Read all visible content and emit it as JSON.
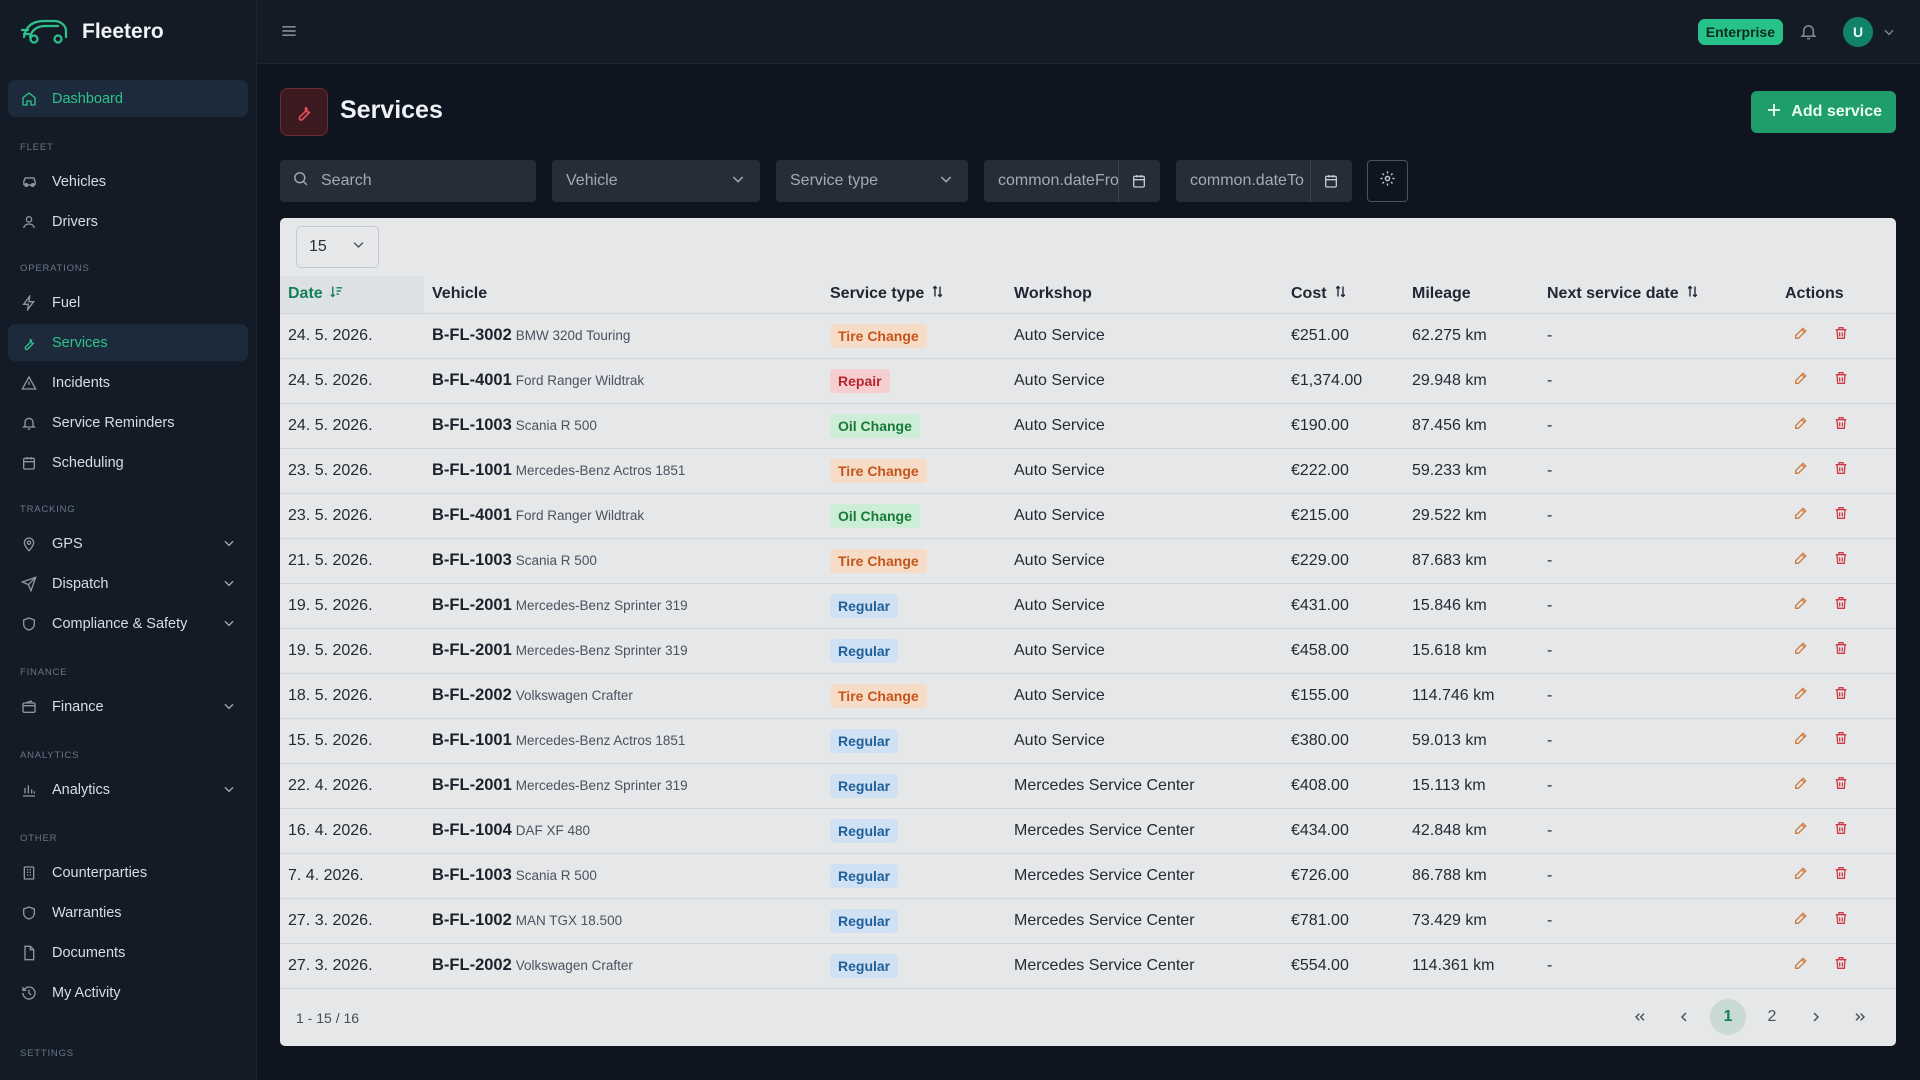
{
  "app": {
    "name": "Fleetero"
  },
  "topbar": {
    "plan_badge": "Enterprise",
    "avatar_initial": "U"
  },
  "sidebar": {
    "dashboard": "Dashboard",
    "sections": {
      "fleet": "FLEET",
      "operations": "OPERATIONS",
      "tracking": "TRACKING",
      "finance": "FINANCE",
      "analytics": "ANALYTICS",
      "other": "OTHER",
      "settings": "SETTINGS"
    },
    "items": {
      "vehicles": "Vehicles",
      "drivers": "Drivers",
      "fuel": "Fuel",
      "services": "Services",
      "incidents": "Incidents",
      "service_reminders": "Service Reminders",
      "scheduling": "Scheduling",
      "gps": "GPS",
      "dispatch": "Dispatch",
      "compliance": "Compliance & Safety",
      "finance": "Finance",
      "analytics": "Analytics",
      "counterparties": "Counterparties",
      "warranties": "Warranties",
      "documents": "Documents",
      "my_activity": "My Activity"
    }
  },
  "page": {
    "title": "Services",
    "add_button": "Add service"
  },
  "filters": {
    "search_placeholder": "Search",
    "vehicle": "Vehicle",
    "service_type": "Service type",
    "date_from": "common.dateFrom",
    "date_to": "common.dateTo"
  },
  "table": {
    "page_size": "15",
    "columns": {
      "date": "Date",
      "vehicle": "Vehicle",
      "service_type": "Service type",
      "workshop": "Workshop",
      "cost": "Cost",
      "mileage": "Mileage",
      "next_service_date": "Next service date",
      "actions": "Actions"
    },
    "rows": [
      {
        "date": "24. 5. 2026.",
        "plate": "B-FL-3002",
        "model": "BMW 320d Touring",
        "type": "Tire Change",
        "type_class": "tire",
        "workshop": "Auto Service",
        "cost": "€251.00",
        "mileage": "62.275 km",
        "next": "-"
      },
      {
        "date": "24. 5. 2026.",
        "plate": "B-FL-4001",
        "model": "Ford Ranger Wildtrak",
        "type": "Repair",
        "type_class": "repair",
        "workshop": "Auto Service",
        "cost": "€1,374.00",
        "mileage": "29.948 km",
        "next": "-"
      },
      {
        "date": "24. 5. 2026.",
        "plate": "B-FL-1003",
        "model": "Scania R 500",
        "type": "Oil Change",
        "type_class": "oil",
        "workshop": "Auto Service",
        "cost": "€190.00",
        "mileage": "87.456 km",
        "next": "-"
      },
      {
        "date": "23. 5. 2026.",
        "plate": "B-FL-1001",
        "model": "Mercedes-Benz Actros 1851",
        "type": "Tire Change",
        "type_class": "tire",
        "workshop": "Auto Service",
        "cost": "€222.00",
        "mileage": "59.233 km",
        "next": "-"
      },
      {
        "date": "23. 5. 2026.",
        "plate": "B-FL-4001",
        "model": "Ford Ranger Wildtrak",
        "type": "Oil Change",
        "type_class": "oil",
        "workshop": "Auto Service",
        "cost": "€215.00",
        "mileage": "29.522 km",
        "next": "-"
      },
      {
        "date": "21. 5. 2026.",
        "plate": "B-FL-1003",
        "model": "Scania R 500",
        "type": "Tire Change",
        "type_class": "tire",
        "workshop": "Auto Service",
        "cost": "€229.00",
        "mileage": "87.683 km",
        "next": "-"
      },
      {
        "date": "19. 5. 2026.",
        "plate": "B-FL-2001",
        "model": "Mercedes-Benz Sprinter 319",
        "type": "Regular",
        "type_class": "regular",
        "workshop": "Auto Service",
        "cost": "€431.00",
        "mileage": "15.846 km",
        "next": "-"
      },
      {
        "date": "19. 5. 2026.",
        "plate": "B-FL-2001",
        "model": "Mercedes-Benz Sprinter 319",
        "type": "Regular",
        "type_class": "regular",
        "workshop": "Auto Service",
        "cost": "€458.00",
        "mileage": "15.618 km",
        "next": "-"
      },
      {
        "date": "18. 5. 2026.",
        "plate": "B-FL-2002",
        "model": "Volkswagen Crafter",
        "type": "Tire Change",
        "type_class": "tire",
        "workshop": "Auto Service",
        "cost": "€155.00",
        "mileage": "114.746 km",
        "next": "-"
      },
      {
        "date": "15. 5. 2026.",
        "plate": "B-FL-1001",
        "model": "Mercedes-Benz Actros 1851",
        "type": "Regular",
        "type_class": "regular",
        "workshop": "Auto Service",
        "cost": "€380.00",
        "mileage": "59.013 km",
        "next": "-"
      },
      {
        "date": "22. 4. 2026.",
        "plate": "B-FL-2001",
        "model": "Mercedes-Benz Sprinter 319",
        "type": "Regular",
        "type_class": "regular",
        "workshop": "Mercedes Service Center",
        "cost": "€408.00",
        "mileage": "15.113 km",
        "next": "-"
      },
      {
        "date": "16. 4. 2026.",
        "plate": "B-FL-1004",
        "model": "DAF XF 480",
        "type": "Regular",
        "type_class": "regular",
        "workshop": "Mercedes Service Center",
        "cost": "€434.00",
        "mileage": "42.848 km",
        "next": "-"
      },
      {
        "date": "7. 4. 2026.",
        "plate": "B-FL-1003",
        "model": "Scania R 500",
        "type": "Regular",
        "type_class": "regular",
        "workshop": "Mercedes Service Center",
        "cost": "€726.00",
        "mileage": "86.788 km",
        "next": "-"
      },
      {
        "date": "27. 3. 2026.",
        "plate": "B-FL-1002",
        "model": "MAN TGX 18.500",
        "type": "Regular",
        "type_class": "regular",
        "workshop": "Mercedes Service Center",
        "cost": "€781.00",
        "mileage": "73.429 km",
        "next": "-"
      },
      {
        "date": "27. 3. 2026.",
        "plate": "B-FL-2002",
        "model": "Volkswagen Crafter",
        "type": "Regular",
        "type_class": "regular",
        "workshop": "Mercedes Service Center",
        "cost": "€554.00",
        "mileage": "114.361 km",
        "next": "-"
      }
    ],
    "footer_count": "1 - 15 / 16",
    "pages": [
      "1",
      "2"
    ],
    "current_page": "1"
  },
  "colors": {
    "accent": "#2ec28b",
    "add_button": "#1f9d6a",
    "danger": "#cf3b45"
  }
}
